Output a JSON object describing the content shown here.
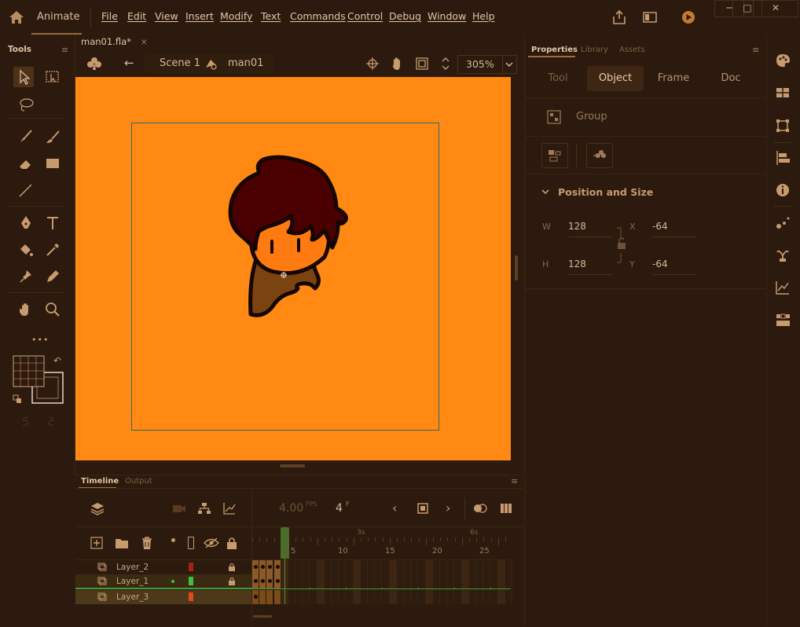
{
  "app": {
    "name": "Animate"
  },
  "menu": [
    "File",
    "Edit",
    "View",
    "Insert",
    "Modify",
    "Text",
    "Commands",
    "Control",
    "Debug",
    "Window",
    "Help"
  ],
  "document_tab": {
    "label": "man01.fla*",
    "close": "×"
  },
  "tools_panel": {
    "title": "Tools",
    "more": "•••",
    "undo": "5",
    "redo": "5"
  },
  "editbar": {
    "scene": "Scene 1",
    "symbol": "man01",
    "zoom": "305%"
  },
  "properties": {
    "tabs": [
      "Properties",
      "Library",
      "Assets"
    ],
    "buttons": [
      "Tool",
      "Object",
      "Frame",
      "Doc"
    ],
    "active_button": "Object",
    "instance_type": "Group",
    "section_title": "Position and Size",
    "w_label": "W",
    "w_value": "128",
    "h_label": "H",
    "h_value": "128",
    "x_label": "X",
    "x_value": "-64",
    "y_label": "Y",
    "y_value": "-64"
  },
  "timeline": {
    "tabs": [
      "Timeline",
      "Output"
    ],
    "fps": "4.00",
    "fps_unit": "FPS",
    "frame": "4",
    "frame_unit": "F",
    "time_marks": [
      "3s",
      "6s"
    ],
    "frame_marks": [
      "5",
      "10",
      "15",
      "20",
      "25"
    ],
    "layers": [
      {
        "name": "Layer_2",
        "color": "#a8201a",
        "locked": true
      },
      {
        "name": "Layer_1",
        "color": "#3fbf3f",
        "locked": true,
        "active": true
      },
      {
        "name": "Layer_3",
        "color": "#e0491a",
        "locked": false,
        "selected": true
      }
    ]
  },
  "colors": {
    "stage": "#ff8913",
    "ui_bg": "#2b1a0d",
    "accent": "#a26d3c"
  }
}
